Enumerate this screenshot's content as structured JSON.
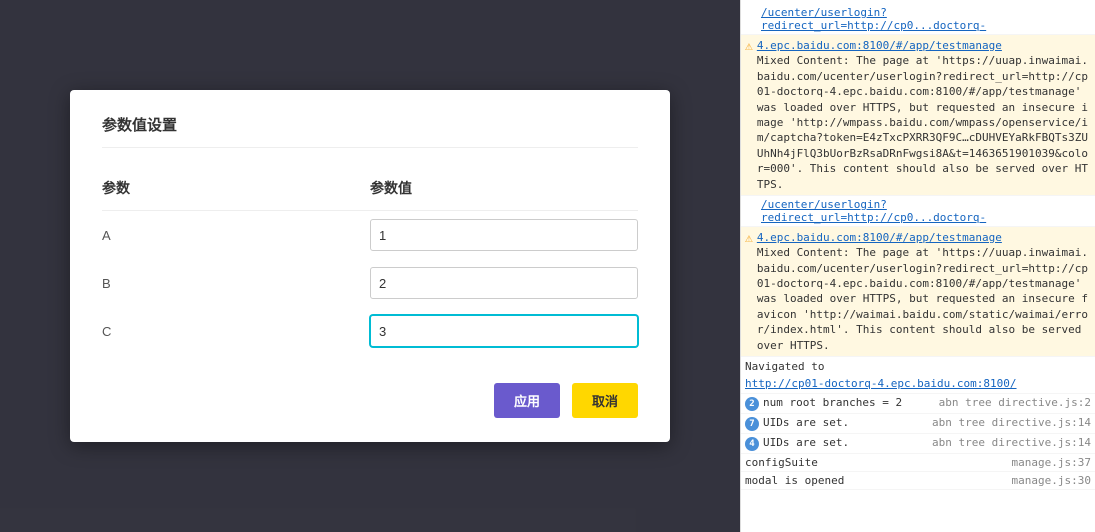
{
  "modal": {
    "title": "参数值设置",
    "columns": {
      "param": "参数",
      "value": "参数值"
    },
    "rows": [
      {
        "label": "A",
        "value": "1"
      },
      {
        "label": "B",
        "value": "2"
      },
      {
        "label": "C",
        "value": "3"
      }
    ],
    "buttons": {
      "apply": "应用",
      "cancel": "取消"
    }
  },
  "console": {
    "lines": [
      {
        "type": "link",
        "text": "/ucenter/userlogin?redirect_url=http://cp0...doctorq-"
      },
      {
        "type": "warn",
        "text": "4.epc.baidu.com:8100/#/app/testmanage",
        "detail": "Mixed Content: The page at 'https://uuap.inwaimai.baidu.com/ucenter/userlogin?redirect_url=http://cp01-doctorq-4.epc.baidu.com:8100/#/app/testmanage' was loaded over HTTPS, but requested an insecure image 'http://wmpass.baidu.com/wmpass/openservice/im/captcha?token=E4zTxcPXRR3QF9C…cDUHVEYaRkFBQTs3ZUUhNh4jFlQ3bUorBzRsaDRnFwgsi8A&t=1463651901039&color=000'. This content should also be served over HTTPS."
      },
      {
        "type": "link",
        "text": "/ucenter/userlogin?redirect_url=http://cp0...doctorq-"
      },
      {
        "type": "warn",
        "text": "4.epc.baidu.com:8100/#/app/testmanage",
        "detail": "Mixed Content: The page at 'https://uuap.inwaimai.baidu.com/ucenter/userlogin?redirect_url=http://cp01-doctorq-4.epc.baidu.com:8100/#/app/testmanage' was loaded over HTTPS, but requested an insecure favicon 'http://waimai.baidu.com/static/waimai/error/index.html'. This content should also be served over HTTPS."
      },
      {
        "type": "nav",
        "prefix": "Navigated to",
        "link": "http://cp01-doctorq-4.epc.baidu.com:8100/"
      },
      {
        "type": "count",
        "badge": "2",
        "badgeColor": "blue",
        "text": "num root branches =",
        "value": "2",
        "file": "abn tree directive.js:2"
      },
      {
        "type": "count",
        "badge": "7",
        "badgeColor": "blue",
        "text": "UIDs are set.",
        "file": "abn tree directive.js:14"
      },
      {
        "type": "count",
        "badge": "4",
        "badgeColor": "blue",
        "text": "UIDs are set.",
        "file": "abn tree directive.js:14"
      },
      {
        "type": "count",
        "badge": "",
        "badgeColor": "",
        "text": "configSuite",
        "file": "manage.js:37"
      },
      {
        "type": "count",
        "badge": "",
        "badgeColor": "",
        "text": "modal is opened",
        "file": "manage.js:30"
      }
    ]
  }
}
